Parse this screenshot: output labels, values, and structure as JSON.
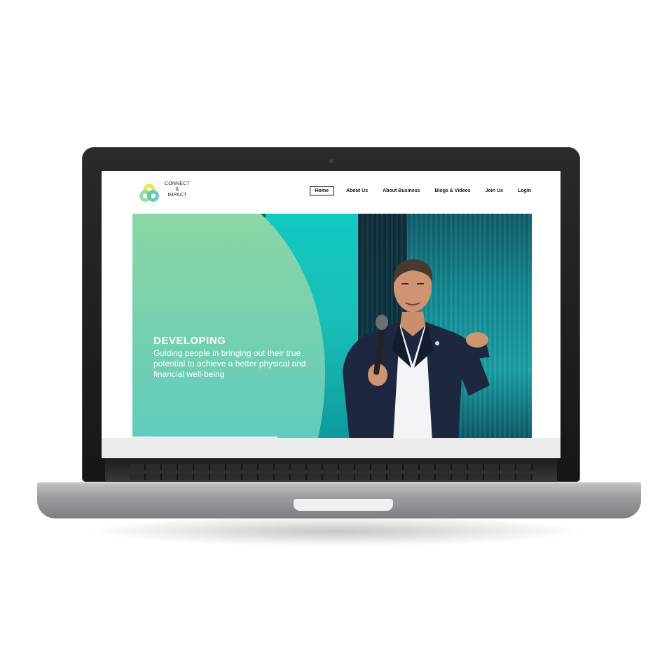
{
  "logo": {
    "line1": "CONNECT",
    "line2": "&",
    "line3": "IMPACT"
  },
  "nav": {
    "items": [
      {
        "label": "Home",
        "active": true
      },
      {
        "label": "About Us",
        "active": false
      },
      {
        "label": "About Business",
        "active": false
      },
      {
        "label": "Blogs & Videos",
        "active": false
      },
      {
        "label": "Join Us",
        "active": false
      },
      {
        "label": "Login",
        "active": false
      }
    ]
  },
  "hero": {
    "title": "DEVELOPING",
    "subtitle": "Guiding people in bringing out their true potential to achieve a better physical and financial well-being"
  },
  "colors": {
    "hero_green": "#93d8a0",
    "hero_teal": "#55c6c4",
    "stage_cyan": "#12c9c2",
    "logo_yellow": "#e9e64a",
    "logo_teal": "#4fc3c0"
  }
}
